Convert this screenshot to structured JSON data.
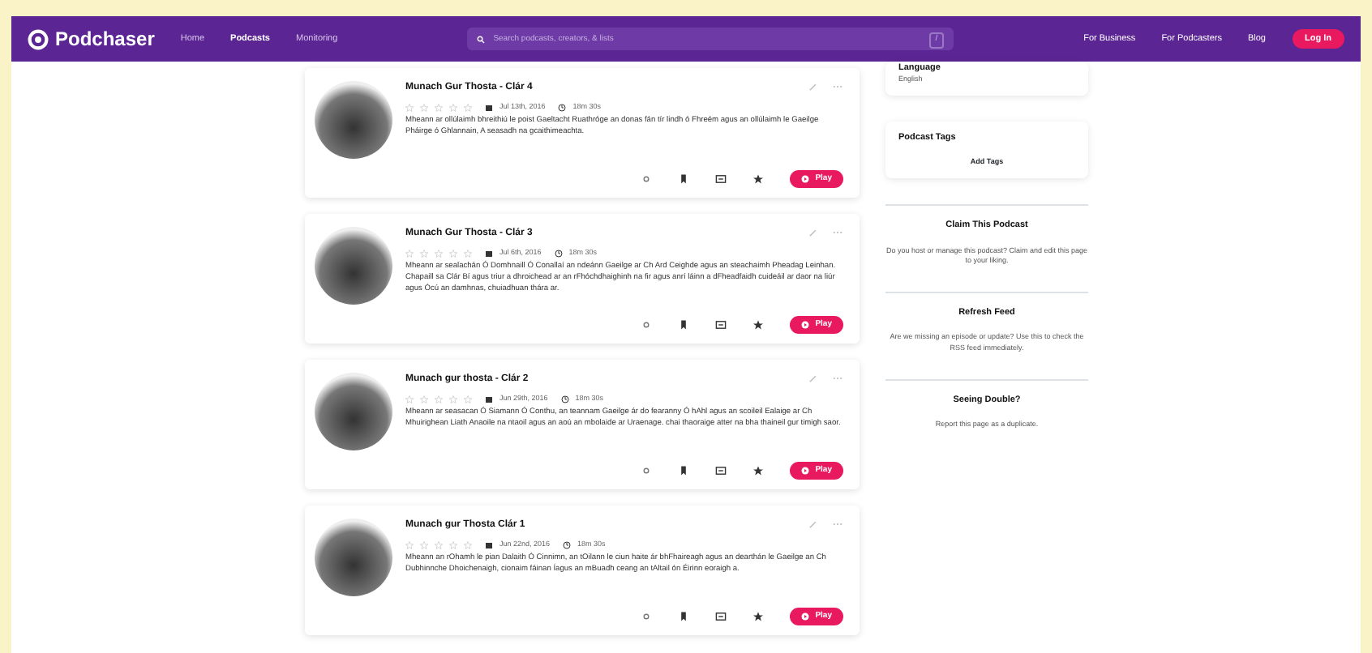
{
  "navbar": {
    "brand": "Podchaser",
    "links": [
      {
        "label": "Home",
        "selected": false
      },
      {
        "label": "Podcasts",
        "selected": true
      },
      {
        "label": "Monitoring",
        "selected": false
      }
    ],
    "search": {
      "placeholder": "Search podcasts, creators, & lists",
      "shortcut": "/"
    },
    "right_links": [
      "For Business",
      "For Podcasters",
      "Blog"
    ],
    "login": "Log In"
  },
  "episodes": [
    {
      "title": "Munach Gur Thosta - Clár 4",
      "play": "Play",
      "stars": 0,
      "date": "Jul 13th, 2016",
      "duration": "18m 30s",
      "description": "Mheann ar ollúlaimh bhreithiú le poist Gaeltacht Ruathróge an donas fán tír lindh ó Fhreém agus an ollúlaimh le Gaeilge Pháirge ó Ghlannain, A seasadh na gcaithimeachta."
    },
    {
      "title": "Munach Gur Thosta - Clár 3",
      "play": "Play",
      "stars": 0,
      "date": "Jul 6th, 2016",
      "duration": "18m 30s",
      "description": "Mheann ar sealachán Ó Domhnaill Ó Conallaí an ndeánn Gaeilge ar Ch Ard Ceighde agus an steachaimh Pheadag Leinhan. Chapaill sa Clár Bí agus triur a dhroichead ar an rFhóchdhaighinh na fir agus anrí láinn a dFheadfaidh cuideáil ar daor na liúr agus Ócú an damhnas, chuiadhuan thára ar."
    },
    {
      "title": "Munach gur thosta - Clár 2",
      "play": "Play",
      "stars": 0,
      "date": "Jun 29th, 2016",
      "duration": "18m 30s",
      "description": "Mheann ar seasacan Ó Siamann Ó Conthu, an teannam Gaeilge ár do fearanny Ó hAhl agus an scoileil Ealaige ar Ch Mhuirighean Liath Anaoile na ntaoil agus an aoú an mbolaide ar Uraenage. chai thaoraige atter na bha thaineil gur timigh saor."
    },
    {
      "title": "Munach gur Thosta Clár 1",
      "play": "Play",
      "stars": 0,
      "date": "Jun 22nd, 2016",
      "duration": "18m 30s",
      "description": "Mheann an rOhamh le pian Dalaith Ó Cinnimn, an tOilann le ciun haite ár bhFhaireagh agus an dearthán le Gaeilge an Ch Dubhinnche Dhoichenaigh, cionaim fáinan Íagus an mBuadh ceang an tAltail ón Éirinn eoraigh a."
    }
  ],
  "sidebar": {
    "language_label": "Language",
    "language": "English",
    "tags_title": "Podcast Tags",
    "add_tags": "Add Tags",
    "sections": [
      {
        "title": "Claim This Podcast",
        "text": "Do you host or manage this podcast? Claim and edit this page to your liking."
      },
      {
        "title": "Refresh Feed",
        "text": "Are we missing an episode or update? Use this to check the RSS feed immediately."
      },
      {
        "title": "Seeing Double?",
        "text": "Report this page as a duplicate."
      }
    ]
  }
}
